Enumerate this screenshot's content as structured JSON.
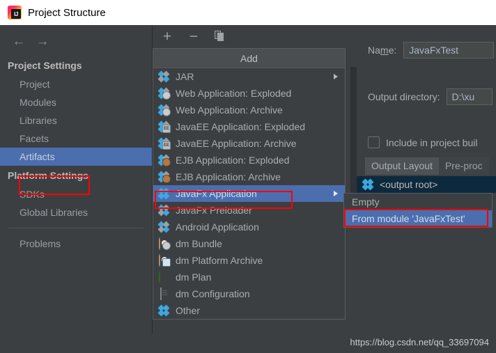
{
  "window": {
    "title": "Project Structure",
    "logo_icon": "intellij-idea-logo"
  },
  "sidebar": {
    "back_icon": "arrow-left-icon",
    "forward_icon": "arrow-right-icon",
    "groups": [
      {
        "heading": "Project Settings",
        "items": [
          {
            "label": "Project",
            "selected": false
          },
          {
            "label": "Modules",
            "selected": false
          },
          {
            "label": "Libraries",
            "selected": false
          },
          {
            "label": "Facets",
            "selected": false
          },
          {
            "label": "Artifacts",
            "selected": true
          }
        ]
      },
      {
        "heading": "Platform Settings",
        "items": [
          {
            "label": "SDKs",
            "selected": false
          },
          {
            "label": "Global Libraries",
            "selected": false
          }
        ]
      }
    ],
    "problems_label": "Problems"
  },
  "mid_toolbar": {
    "add_icon": "plus-icon",
    "remove_icon": "minus-icon",
    "copy_icon": "copy-icon"
  },
  "popup_menu": {
    "title": "Add",
    "items": [
      {
        "label": "JAR",
        "icon": "artifact-diamond-icon",
        "submenu": true,
        "selected": false
      },
      {
        "label": "Web Application: Exploded",
        "icon": "web-artifact-icon",
        "submenu": false,
        "selected": false
      },
      {
        "label": "Web Application: Archive",
        "icon": "web-artifact-icon",
        "submenu": false,
        "selected": false
      },
      {
        "label": "JavaEE Application: Exploded",
        "icon": "javaee-artifact-icon",
        "submenu": false,
        "selected": false
      },
      {
        "label": "JavaEE Application: Archive",
        "icon": "javaee-artifact-icon",
        "submenu": false,
        "selected": false
      },
      {
        "label": "EJB Application: Exploded",
        "icon": "ejb-artifact-icon",
        "submenu": false,
        "selected": false
      },
      {
        "label": "EJB Application: Archive",
        "icon": "ejb-artifact-icon",
        "submenu": false,
        "selected": false
      },
      {
        "label": "JavaFx Application",
        "icon": "artifact-diamond-icon",
        "submenu": true,
        "selected": true
      },
      {
        "label": "JavaFx Preloader",
        "icon": "artifact-diamond-icon",
        "submenu": false,
        "selected": false
      },
      {
        "label": "Android Application",
        "icon": "artifact-diamond-icon",
        "submenu": false,
        "selected": false
      },
      {
        "label": "dm Bundle",
        "icon": "dm-bundle-icon",
        "submenu": false,
        "selected": false
      },
      {
        "label": "dm Platform Archive",
        "icon": "dm-platform-archive-icon",
        "submenu": false,
        "selected": false
      },
      {
        "label": "dm Plan",
        "icon": "dm-plan-icon",
        "submenu": false,
        "selected": false
      },
      {
        "label": "dm Configuration",
        "icon": "dm-configuration-icon",
        "submenu": false,
        "selected": false
      },
      {
        "label": "Other",
        "icon": "artifact-diamond-icon",
        "submenu": false,
        "selected": false
      }
    ]
  },
  "submenu": {
    "items": [
      {
        "label": "Empty",
        "selected": false
      },
      {
        "label": "From module 'JavaFxTest'",
        "selected": true
      }
    ]
  },
  "right_panel": {
    "name_label_pre": "Na",
    "name_label_mnemonic": "m",
    "name_label_post": "e:",
    "name_value": "JavaFxTest",
    "output_directory_label": "Output directory:",
    "output_directory_value": "D:\\xu",
    "include_checkbox_label": "Include in project buil",
    "include_checkbox_mnemonic": "b",
    "include_checkbox_checked": false,
    "tabs": [
      {
        "label": "Output Layout",
        "active": true
      },
      {
        "label": "Pre-proc",
        "active": false
      }
    ],
    "toolbar": {
      "add_folder_icon": "folder-add-icon",
      "archive_icon": "archive-icon",
      "add_icon": "plus-dropdown-icon",
      "remove_icon": "minus-icon",
      "sort_icon": "sort-az-icon",
      "up_icon": "caret-up-icon"
    },
    "tree_root_label": "<output root>",
    "tree_root_icon": "artifact-diamond-icon"
  },
  "watermark": "https://blog.csdn.net/qq_33697094",
  "colors": {
    "background": "#3c3f41",
    "titlebar": "#ffffff",
    "selection_blue": "#4b6eaf",
    "tree_selection_navy": "#0d293e",
    "annotation_red": "#ff0000",
    "icon_blue": "#3da8e0",
    "text_primary": "#a9aeb2"
  }
}
